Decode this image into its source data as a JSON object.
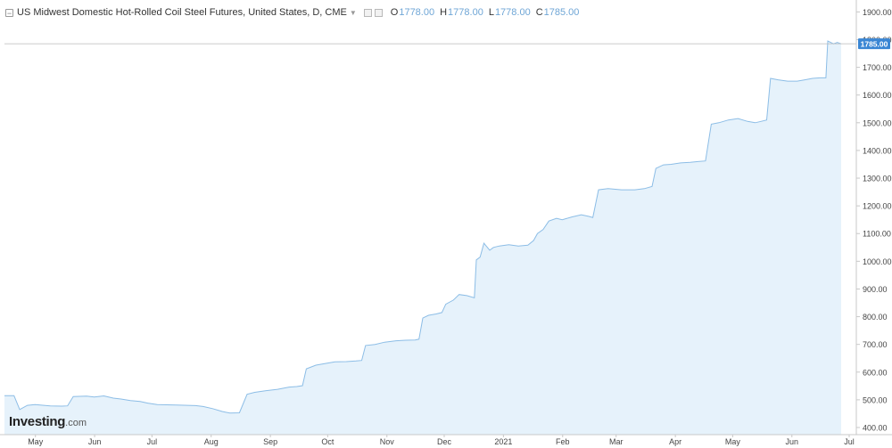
{
  "legend": {
    "title": "US Midwest Domestic Hot-Rolled Coil Steel Futures, United States, D, CME",
    "open_key": "O",
    "open": "1778.00",
    "high_key": "H",
    "high": "1778.00",
    "low_key": "L",
    "low": "1778.00",
    "close_key": "C",
    "close": "1785.00"
  },
  "logo": {
    "brand": "Investing",
    "suffix": ".com"
  },
  "chart_data": {
    "type": "area",
    "title": "US Midwest Domestic Hot-Rolled Coil Steel Futures, United States, D, CME",
    "xlabel": "",
    "ylabel": "",
    "ylim": [
      380,
      1950
    ],
    "y_ticks": [
      400,
      500,
      600,
      700,
      800,
      900,
      1000,
      1100,
      1200,
      1300,
      1400,
      1500,
      1600,
      1700,
      1800,
      1900
    ],
    "x_ticks": [
      "May",
      "Jun",
      "Jul",
      "Aug",
      "Sep",
      "Oct",
      "Nov",
      "Dec",
      "2021",
      "Feb",
      "Mar",
      "Apr",
      "May",
      "Jun",
      "Jul"
    ],
    "last_price": "1785.00",
    "grid": false,
    "colors": {
      "line": "#8cbde6",
      "fill": "#e6f2fb",
      "last_price_label": "#3a86d4",
      "axis": "#c8c8c8"
    },
    "series": [
      {
        "points": [
          [
            "2020-04-26",
            515
          ],
          [
            "2020-05-01",
            515
          ],
          [
            "2020-05-04",
            465
          ],
          [
            "2020-05-08",
            480
          ],
          [
            "2020-05-12",
            483
          ],
          [
            "2020-05-20",
            478
          ],
          [
            "2020-05-26",
            477
          ],
          [
            "2020-05-29",
            478
          ],
          [
            "2020-06-01",
            512
          ],
          [
            "2020-06-08",
            513
          ],
          [
            "2020-06-12",
            510
          ],
          [
            "2020-06-17",
            514
          ],
          [
            "2020-06-22",
            506
          ],
          [
            "2020-06-26",
            503
          ],
          [
            "2020-07-01",
            497
          ],
          [
            "2020-07-06",
            494
          ],
          [
            "2020-07-10",
            488
          ],
          [
            "2020-07-15",
            483
          ],
          [
            "2020-07-20",
            482
          ],
          [
            "2020-07-25",
            481
          ],
          [
            "2020-07-31",
            480
          ],
          [
            "2020-08-04",
            479
          ],
          [
            "2020-08-08",
            476
          ],
          [
            "2020-08-13",
            468
          ],
          [
            "2020-08-18",
            458
          ],
          [
            "2020-08-22",
            452
          ],
          [
            "2020-08-27",
            453
          ],
          [
            "2020-08-31",
            520
          ],
          [
            "2020-09-04",
            527
          ],
          [
            "2020-09-10",
            533
          ],
          [
            "2020-09-16",
            538
          ],
          [
            "2020-09-22",
            546
          ],
          [
            "2020-09-26",
            548
          ],
          [
            "2020-09-29",
            551
          ],
          [
            "2020-10-01",
            612
          ],
          [
            "2020-10-06",
            625
          ],
          [
            "2020-10-10",
            630
          ],
          [
            "2020-10-16",
            637
          ],
          [
            "2020-10-22",
            638
          ],
          [
            "2020-10-27",
            640
          ],
          [
            "2020-10-30",
            642
          ],
          [
            "2020-11-01",
            696
          ],
          [
            "2020-11-06",
            700
          ],
          [
            "2020-11-11",
            708
          ],
          [
            "2020-11-17",
            713
          ],
          [
            "2020-11-22",
            715
          ],
          [
            "2020-11-27",
            716
          ],
          [
            "2020-11-29",
            719
          ],
          [
            "2020-12-01",
            795
          ],
          [
            "2020-12-04",
            805
          ],
          [
            "2020-12-08",
            810
          ],
          [
            "2020-12-11",
            815
          ],
          [
            "2020-12-13",
            845
          ],
          [
            "2020-12-17",
            860
          ],
          [
            "2020-12-20",
            880
          ],
          [
            "2020-12-24",
            876
          ],
          [
            "2020-12-28",
            868
          ],
          [
            "2020-12-29",
            1005
          ],
          [
            "2020-12-31",
            1015
          ],
          [
            "2021-01-02",
            1065
          ],
          [
            "2021-01-05",
            1040
          ],
          [
            "2021-01-07",
            1050
          ],
          [
            "2021-01-10",
            1055
          ],
          [
            "2021-01-15",
            1060
          ],
          [
            "2021-01-20",
            1055
          ],
          [
            "2021-01-25",
            1058
          ],
          [
            "2021-01-28",
            1075
          ],
          [
            "2021-01-30",
            1100
          ],
          [
            "2021-02-02",
            1115
          ],
          [
            "2021-02-05",
            1145
          ],
          [
            "2021-02-09",
            1155
          ],
          [
            "2021-02-12",
            1150
          ],
          [
            "2021-02-17",
            1160
          ],
          [
            "2021-02-22",
            1168
          ],
          [
            "2021-02-26",
            1162
          ],
          [
            "2021-02-28",
            1158
          ],
          [
            "2021-03-03",
            1258
          ],
          [
            "2021-03-08",
            1262
          ],
          [
            "2021-03-15",
            1258
          ],
          [
            "2021-03-22",
            1258
          ],
          [
            "2021-03-27",
            1262
          ],
          [
            "2021-03-31",
            1270
          ],
          [
            "2021-04-02",
            1335
          ],
          [
            "2021-04-06",
            1348
          ],
          [
            "2021-04-10",
            1350
          ],
          [
            "2021-04-15",
            1355
          ],
          [
            "2021-04-20",
            1357
          ],
          [
            "2021-04-24",
            1360
          ],
          [
            "2021-04-28",
            1362
          ],
          [
            "2021-05-01",
            1495
          ],
          [
            "2021-05-05",
            1500
          ],
          [
            "2021-05-10",
            1510
          ],
          [
            "2021-05-15",
            1515
          ],
          [
            "2021-05-20",
            1505
          ],
          [
            "2021-05-24",
            1500
          ],
          [
            "2021-05-27",
            1505
          ],
          [
            "2021-05-30",
            1510
          ],
          [
            "2021-06-01",
            1660
          ],
          [
            "2021-06-05",
            1655
          ],
          [
            "2021-06-10",
            1650
          ],
          [
            "2021-06-15",
            1650
          ],
          [
            "2021-06-19",
            1655
          ],
          [
            "2021-06-23",
            1660
          ],
          [
            "2021-06-27",
            1662
          ],
          [
            "2021-06-30",
            1662
          ],
          [
            "2021-07-01",
            1795
          ],
          [
            "2021-07-04",
            1785
          ],
          [
            "2021-07-06",
            1790
          ],
          [
            "2021-07-08",
            1785
          ]
        ]
      }
    ]
  }
}
